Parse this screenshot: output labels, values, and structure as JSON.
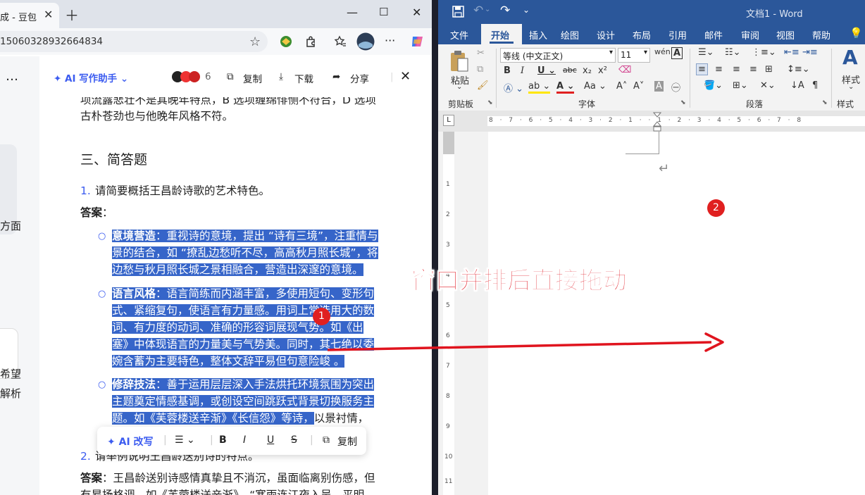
{
  "browser": {
    "tab_title": "成 - 豆包",
    "url": "15060328932664834",
    "side_texts": [
      "…",
      "方面",
      "希望",
      "解析"
    ],
    "toolbar": {
      "ai_assistant": "AI 写作助手",
      "avatar_count": "6",
      "copy": "复制",
      "download": "下载",
      "share": "分享"
    },
    "content": {
      "line_top1": "项流露悲壮不是其晚年特点，B 选项缠绵悱恻不符合，D 选项",
      "line_top2": "古朴苍劲也与他晚年风格不符。",
      "section_heading": "三、简答题",
      "q1_num": "1.",
      "q1": "请简要概括王昌龄诗歌的艺术特色。",
      "answer_label": "答案",
      "answer_colon": "：",
      "b1_title": "意境营造",
      "b1_l1": "：重视诗的意境，提出 “诗有三境”，注重情与",
      "b1_l2": "景的结合，如 “撩乱边愁听不尽，高高秋月照长城”，将",
      "b1_l3": "边愁与秋月照长城之景相融合，营造出深邃的意境。",
      "b2_title": "语言风格",
      "b2_l1": "：语言简练而内涵丰富，多使用短句、变形句",
      "b2_l2": "式、紧缩复句，使语言有力量感。用词上常选用大的数",
      "b2_l3": "词、有力度的动词、准确的形容词展现气势。如《出",
      "b2_l4": "塞》中体现语言的力量美与气势美。同时，其七绝以委",
      "b2_l5": "婉含蓄为主要特色，整体文辞平易但句意险峻 。",
      "b3_title": "修辞技法",
      "b3_l1": "：善于运用层层深入手法烘托环境氛围为突出",
      "b3_l2": "主题奠定情感基调，或创设空间跳跃式背景切换服务主",
      "b3_l3": "题。如《芙蓉楼送辛渐》《长信怨》等诗，",
      "b3_l3_rest": "以景衬情，",
      "q2_num": "2.",
      "q2": "请举例说明王昌龄送别诗的特点。",
      "a2_label": "答案",
      "a2_l1": "：王昌龄送别诗感情真挚且不消沉，虽面临离别伤感，但",
      "a2_l2": "有昂扬格调，如《芙蓉楼送辛渐》，“寒雨连江夜入吴，平明"
    },
    "float_toolbar": {
      "ai_rewrite": "AI 改写",
      "copy": "复制"
    }
  },
  "word": {
    "title": "文档1  -  Word",
    "tabs": [
      "文件",
      "开始",
      "插入",
      "绘图",
      "设计",
      "布局",
      "引用",
      "邮件",
      "审阅",
      "视图",
      "帮助"
    ],
    "active_tab": "开始",
    "font_name": "等线 (中文正文)",
    "font_size": "11",
    "paste_label": "粘贴",
    "style_label": "样式",
    "groups": [
      "剪贴板",
      "字体",
      "段落",
      "样式"
    ],
    "vruler_numbers": [
      "1",
      "2",
      "3",
      "4",
      "5",
      "6",
      "7",
      "8",
      "9",
      "10",
      "11"
    ],
    "hruler_text": "8 · 7 · 6 · 5 · 4 · 3 · 2 · 1 ·    · 1 · 2 · 3 · 4 · 5 · 6 · 7 · 8"
  },
  "annotations": {
    "badge1": "1",
    "badge2": "2",
    "overlay_text": "窗口并排后直接拖动",
    "arrow_color": "#e0141e"
  }
}
